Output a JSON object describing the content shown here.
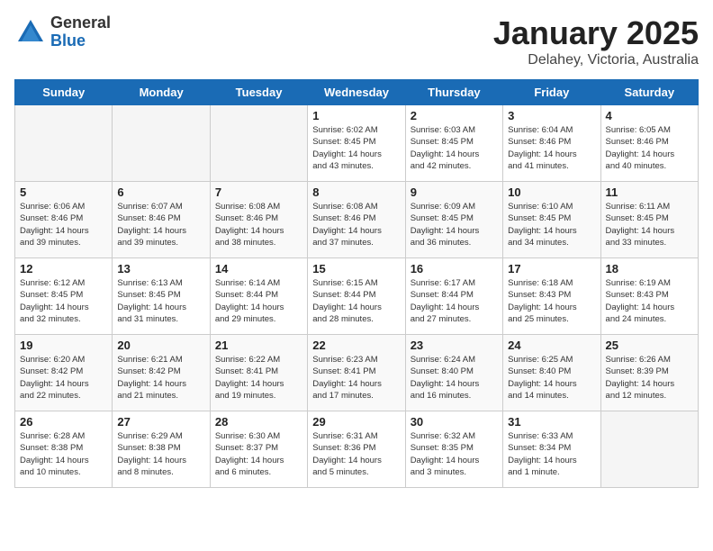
{
  "header": {
    "logo_general": "General",
    "logo_blue": "Blue",
    "title": "January 2025",
    "subtitle": "Delahey, Victoria, Australia"
  },
  "weekdays": [
    "Sunday",
    "Monday",
    "Tuesday",
    "Wednesday",
    "Thursday",
    "Friday",
    "Saturday"
  ],
  "weeks": [
    [
      {
        "day": null,
        "info": null
      },
      {
        "day": null,
        "info": null
      },
      {
        "day": null,
        "info": null
      },
      {
        "day": "1",
        "info": "Sunrise: 6:02 AM\nSunset: 8:45 PM\nDaylight: 14 hours\nand 43 minutes."
      },
      {
        "day": "2",
        "info": "Sunrise: 6:03 AM\nSunset: 8:45 PM\nDaylight: 14 hours\nand 42 minutes."
      },
      {
        "day": "3",
        "info": "Sunrise: 6:04 AM\nSunset: 8:46 PM\nDaylight: 14 hours\nand 41 minutes."
      },
      {
        "day": "4",
        "info": "Sunrise: 6:05 AM\nSunset: 8:46 PM\nDaylight: 14 hours\nand 40 minutes."
      }
    ],
    [
      {
        "day": "5",
        "info": "Sunrise: 6:06 AM\nSunset: 8:46 PM\nDaylight: 14 hours\nand 39 minutes."
      },
      {
        "day": "6",
        "info": "Sunrise: 6:07 AM\nSunset: 8:46 PM\nDaylight: 14 hours\nand 39 minutes."
      },
      {
        "day": "7",
        "info": "Sunrise: 6:08 AM\nSunset: 8:46 PM\nDaylight: 14 hours\nand 38 minutes."
      },
      {
        "day": "8",
        "info": "Sunrise: 6:08 AM\nSunset: 8:46 PM\nDaylight: 14 hours\nand 37 minutes."
      },
      {
        "day": "9",
        "info": "Sunrise: 6:09 AM\nSunset: 8:45 PM\nDaylight: 14 hours\nand 36 minutes."
      },
      {
        "day": "10",
        "info": "Sunrise: 6:10 AM\nSunset: 8:45 PM\nDaylight: 14 hours\nand 34 minutes."
      },
      {
        "day": "11",
        "info": "Sunrise: 6:11 AM\nSunset: 8:45 PM\nDaylight: 14 hours\nand 33 minutes."
      }
    ],
    [
      {
        "day": "12",
        "info": "Sunrise: 6:12 AM\nSunset: 8:45 PM\nDaylight: 14 hours\nand 32 minutes."
      },
      {
        "day": "13",
        "info": "Sunrise: 6:13 AM\nSunset: 8:45 PM\nDaylight: 14 hours\nand 31 minutes."
      },
      {
        "day": "14",
        "info": "Sunrise: 6:14 AM\nSunset: 8:44 PM\nDaylight: 14 hours\nand 29 minutes."
      },
      {
        "day": "15",
        "info": "Sunrise: 6:15 AM\nSunset: 8:44 PM\nDaylight: 14 hours\nand 28 minutes."
      },
      {
        "day": "16",
        "info": "Sunrise: 6:17 AM\nSunset: 8:44 PM\nDaylight: 14 hours\nand 27 minutes."
      },
      {
        "day": "17",
        "info": "Sunrise: 6:18 AM\nSunset: 8:43 PM\nDaylight: 14 hours\nand 25 minutes."
      },
      {
        "day": "18",
        "info": "Sunrise: 6:19 AM\nSunset: 8:43 PM\nDaylight: 14 hours\nand 24 minutes."
      }
    ],
    [
      {
        "day": "19",
        "info": "Sunrise: 6:20 AM\nSunset: 8:42 PM\nDaylight: 14 hours\nand 22 minutes."
      },
      {
        "day": "20",
        "info": "Sunrise: 6:21 AM\nSunset: 8:42 PM\nDaylight: 14 hours\nand 21 minutes."
      },
      {
        "day": "21",
        "info": "Sunrise: 6:22 AM\nSunset: 8:41 PM\nDaylight: 14 hours\nand 19 minutes."
      },
      {
        "day": "22",
        "info": "Sunrise: 6:23 AM\nSunset: 8:41 PM\nDaylight: 14 hours\nand 17 minutes."
      },
      {
        "day": "23",
        "info": "Sunrise: 6:24 AM\nSunset: 8:40 PM\nDaylight: 14 hours\nand 16 minutes."
      },
      {
        "day": "24",
        "info": "Sunrise: 6:25 AM\nSunset: 8:40 PM\nDaylight: 14 hours\nand 14 minutes."
      },
      {
        "day": "25",
        "info": "Sunrise: 6:26 AM\nSunset: 8:39 PM\nDaylight: 14 hours\nand 12 minutes."
      }
    ],
    [
      {
        "day": "26",
        "info": "Sunrise: 6:28 AM\nSunset: 8:38 PM\nDaylight: 14 hours\nand 10 minutes."
      },
      {
        "day": "27",
        "info": "Sunrise: 6:29 AM\nSunset: 8:38 PM\nDaylight: 14 hours\nand 8 minutes."
      },
      {
        "day": "28",
        "info": "Sunrise: 6:30 AM\nSunset: 8:37 PM\nDaylight: 14 hours\nand 6 minutes."
      },
      {
        "day": "29",
        "info": "Sunrise: 6:31 AM\nSunset: 8:36 PM\nDaylight: 14 hours\nand 5 minutes."
      },
      {
        "day": "30",
        "info": "Sunrise: 6:32 AM\nSunset: 8:35 PM\nDaylight: 14 hours\nand 3 minutes."
      },
      {
        "day": "31",
        "info": "Sunrise: 6:33 AM\nSunset: 8:34 PM\nDaylight: 14 hours\nand 1 minute."
      },
      {
        "day": null,
        "info": null
      }
    ]
  ]
}
